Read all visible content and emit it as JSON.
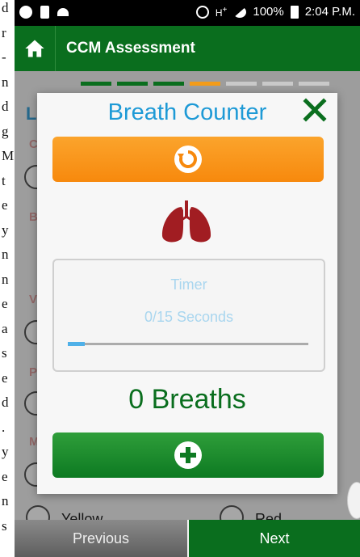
{
  "doc_strip": [
    "d",
    "r",
    "-",
    "n",
    "d",
    "g",
    "M",
    "t",
    "e",
    "y",
    "n",
    "n",
    "e",
    "a",
    "s",
    "e",
    "d",
    ".",
    "y",
    "e",
    "n",
    "s"
  ],
  "status_bar": {
    "battery": "100%",
    "time": "2:04 P.M."
  },
  "app": {
    "title": "CCM Assessment"
  },
  "steps": [
    "done",
    "done",
    "done",
    "current",
    "todo",
    "todo",
    "todo"
  ],
  "background_form": {
    "letters": [
      "L",
      "C",
      "B",
      "V",
      "P",
      "M"
    ],
    "option_yellow": "Yellow",
    "option_red": "Red"
  },
  "dialog": {
    "title": "Breath Counter",
    "timer_label": "Timer",
    "timer_seconds": "0/15 Seconds",
    "timer_progress": 0.07,
    "breaths": "0 Breaths",
    "colors": {
      "title": "#1e9ad6",
      "reset": "#f7890d",
      "add": "#0d7a22",
      "lungs": "#a11d22"
    }
  },
  "nav": {
    "previous": "Previous",
    "next": "Next"
  }
}
